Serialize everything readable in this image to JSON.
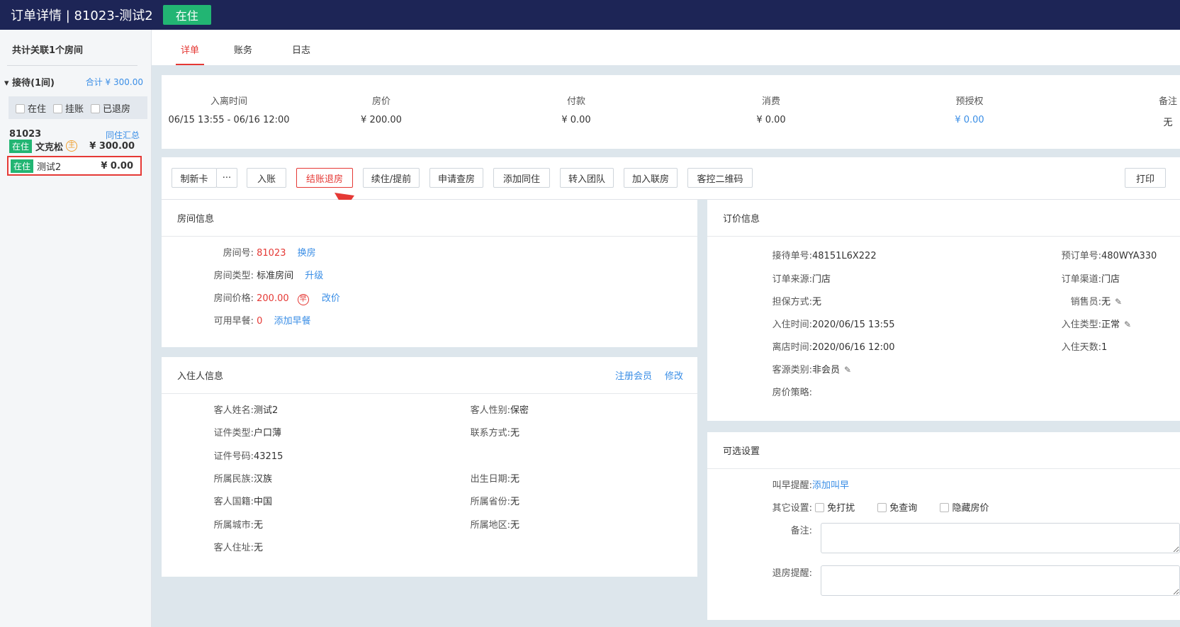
{
  "header": {
    "title": "订单详情 | 81023-测试2",
    "status": "在住"
  },
  "sidebar": {
    "title": "共计关联1个房间",
    "group": {
      "name": "接待(1间)",
      "total": "合计 ¥ 300.00"
    },
    "filters": [
      "在住",
      "挂账",
      "已退房"
    ],
    "room": {
      "number": "81023",
      "link": "同住汇总"
    },
    "guests": [
      {
        "badge": "在住",
        "name": "文克松",
        "icon": "主",
        "amount": "¥ 300.00"
      },
      {
        "badge": "在住",
        "name": "测试2",
        "amount": "¥ 0.00"
      }
    ]
  },
  "tabs": [
    "详单",
    "账务",
    "日志"
  ],
  "summary": [
    {
      "label": "入离时间",
      "value": "06/15 13:55 - 06/16 12:00"
    },
    {
      "label": "房价",
      "value": "¥ 200.00"
    },
    {
      "label": "付款",
      "value": "¥ 0.00"
    },
    {
      "label": "消费",
      "value": "¥ 0.00"
    },
    {
      "label": "预授权",
      "value": "¥ 0.00"
    },
    {
      "label": "备注",
      "value": "无"
    }
  ],
  "actions": {
    "make_card": "制新卡",
    "more": "···",
    "post": "入账",
    "checkout": "结账退房",
    "extend": "续住/提前",
    "inspect": "申请查房",
    "add_cohabitant": "添加同住",
    "to_group": "转入团队",
    "join_linked": "加入联房",
    "qr": "客控二维码",
    "print": "打印"
  },
  "room_info": {
    "title": "房间信息",
    "room_no_label": "房间号:",
    "room_no": "81023",
    "change_room": "换房",
    "type_label": "房间类型:",
    "type": "标准房间",
    "upgrade": "升级",
    "price_label": "房间价格:",
    "price": "200.00",
    "bfast_icon": "早",
    "change_price": "改价",
    "breakfast_label": "可用早餐:",
    "breakfast": "0",
    "add_breakfast": "添加早餐"
  },
  "guest_info": {
    "title": "入住人信息",
    "register": "注册会员",
    "edit": "修改",
    "name_label": "客人姓名:",
    "name": "测试2",
    "gender_label": "客人性别:",
    "gender": "保密",
    "id_type_label": "证件类型:",
    "id_type": "户口薄",
    "contact_label": "联系方式:",
    "contact": "无",
    "id_no_label": "证件号码:",
    "id_no": "43215",
    "ethnic_label": "所属民族:",
    "ethnic": "汉族",
    "birth_label": "出生日期:",
    "birth": "无",
    "nation_label": "客人国籍:",
    "nation": "中国",
    "province_label": "所属省份:",
    "province": "无",
    "city_label": "所属城市:",
    "city": "无",
    "district_label": "所属地区:",
    "district": "无",
    "address_label": "客人住址:",
    "address": "无"
  },
  "pricing": {
    "title": "订价信息",
    "recv_no_label": "接待单号:",
    "recv_no": "48151L6X222",
    "book_no_label": "预订单号:",
    "book_no": "480WYA330",
    "source_label": "订单来源:",
    "source": "门店",
    "channel_label": "订单渠道:",
    "channel": "门店",
    "guarantee_label": "担保方式:",
    "guarantee": "无",
    "sales_label": "销售员:",
    "sales": "无",
    "checkin_label": "入住时间:",
    "checkin": "2020/06/15 13:55",
    "stay_type_label": "入住类型:",
    "stay_type": "正常",
    "checkout_label": "离店时间:",
    "checkout": "2020/06/16 12:00",
    "days_label": "入住天数:",
    "days": "1",
    "category_label": "客源类别:",
    "category": "非会员",
    "policy_label": "房价策略:"
  },
  "options": {
    "title": "可选设置",
    "wake_label": "叫早提醒:",
    "wake": "添加叫早",
    "other_label": "其它设置:",
    "dnd": "免打扰",
    "no_inquiry": "免查询",
    "hide_price": "隐藏房价",
    "note_label": "备注:",
    "checkout_remind_label": "退房提醒:"
  }
}
